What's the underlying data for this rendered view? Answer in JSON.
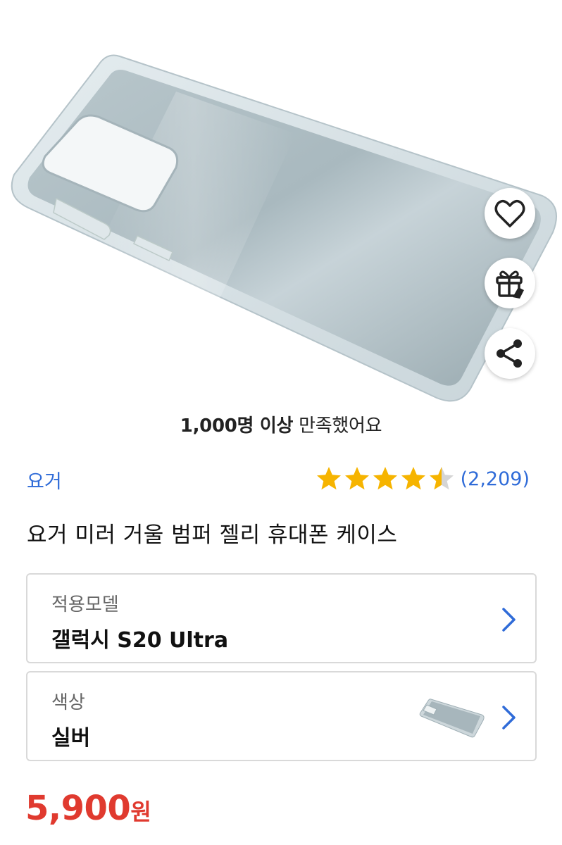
{
  "product": {
    "image_icon": "phone-case-photo",
    "satisfaction_bold": "1,000명 이상",
    "satisfaction_rest": " 만족했어요",
    "brand": "요거",
    "rating": 4.5,
    "rating_count": "(2,209)",
    "title": "요거 미러 거울 범퍼 젤리 휴대폰 케이스",
    "price_amount": "5,900",
    "price_unit": "원"
  },
  "actions": {
    "like_icon": "heart-icon",
    "gift_icon": "gift-icon",
    "share_icon": "share-icon"
  },
  "options": {
    "model": {
      "label": "적용모델",
      "value": "갤럭시 S20 Ultra"
    },
    "color": {
      "label": "색상",
      "value": "실버",
      "thumb_icon": "silver-case-thumbnail"
    }
  },
  "colors": {
    "accent_blue": "#2f6bd8",
    "price_red": "#e03a2f",
    "star_gold": "#f6b400",
    "star_empty": "#d5d5d5"
  }
}
